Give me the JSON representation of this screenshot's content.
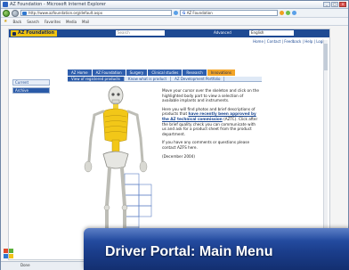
{
  "browser": {
    "window_title": "AZ Foundation - Microsoft Internet Explorer",
    "address": "http://www.azfoundation.org/default.aspx",
    "search_box": "AZ Foundation",
    "favorites_label": "Favorites",
    "favorites_items": [
      "Back",
      "Search",
      "Favorites",
      "Media",
      "Mail"
    ],
    "status_text": "Done"
  },
  "site": {
    "logo_text": "AZ Foundation",
    "search_placeholder": "Search",
    "advanced_label": "Advanced",
    "region_value": "English",
    "utility_links": "Home | Contact | Feedback | Help | Login",
    "sidebar_items": [
      "Current",
      "Archive"
    ],
    "tabs": [
      "AZ Home",
      "AZ Foundation",
      "Surgery",
      "Clinical studies",
      "Research",
      "Innovations"
    ],
    "active_tab_index": 5,
    "subtabs": [
      "View of registered products",
      "Know what is product",
      "AZ Development Portfolio"
    ],
    "active_subtab_index": 0
  },
  "content": {
    "p1": "Move your cursor over the skeleton and click on the highlighted body part to view a selection of available implants and instruments.",
    "p2_pre": "Here you will find photos and brief descriptions of products that ",
    "p2_highlight": "have recently been approved by the AZ technical commission",
    "p2_post": " (AZTC). Click after the brief quality check you can communicate with us and ask for a product sheet from the product department.",
    "p3": "If you have any comments or questions please contact AZFS here.",
    "p4": "(December 2004)"
  },
  "banner": {
    "title": "Driver Portal:  Main Menu"
  },
  "colors": {
    "header_blue": "#1e4a93",
    "tab_blue": "#2f5fae",
    "active_tab_orange": "#f2a427",
    "highlight_yellow": "#f1c40f"
  }
}
